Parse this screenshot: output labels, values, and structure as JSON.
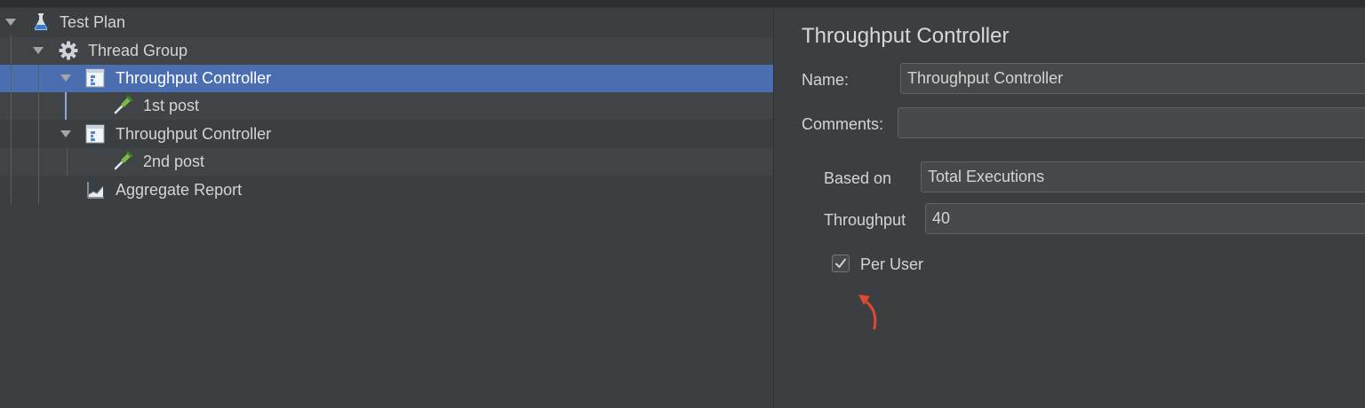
{
  "tree": {
    "items": [
      {
        "label": "Test Plan",
        "icon": "flask-icon"
      },
      {
        "label": "Thread Group",
        "icon": "gear-icon"
      },
      {
        "label": "Throughput Controller",
        "icon": "controller-icon"
      },
      {
        "label": "1st post",
        "icon": "pipette-icon"
      },
      {
        "label": "Throughput Controller",
        "icon": "controller-icon"
      },
      {
        "label": "2nd post",
        "icon": "pipette-icon"
      },
      {
        "label": "Aggregate Report",
        "icon": "report-chart-icon"
      }
    ]
  },
  "panel": {
    "title": "Throughput Controller",
    "name_label": "Name:",
    "name_value": "Throughput Controller",
    "comments_label": "Comments:",
    "comments_value": "",
    "based_on_label": "Based on",
    "based_on_value": "Total Executions",
    "throughput_label": "Throughput",
    "throughput_value": "40",
    "per_user_label": "Per User",
    "per_user_checked": true
  },
  "colors": {
    "background": "#3c3f41",
    "selection": "#4a6eb0",
    "annotation_arrow": "#e0492d"
  }
}
